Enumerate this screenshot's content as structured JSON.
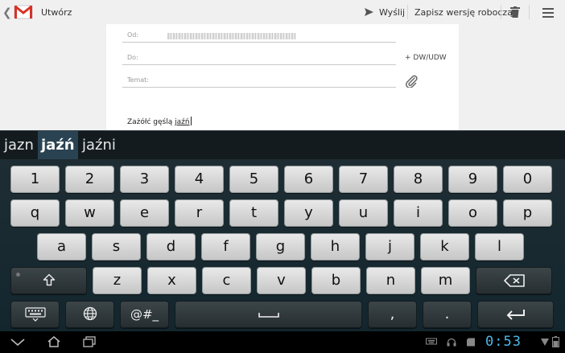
{
  "actionbar": {
    "title": "Utwórz",
    "send_label": "Wyślij",
    "save_draft_label": "Zapisz wersję roboczą"
  },
  "compose": {
    "from_label": "Od:",
    "to_label": "Do:",
    "subject_label": "Temat:",
    "cc_bcc_label": "+ DW/UDW",
    "body_prefix": "Zażółć gęślą ",
    "body_current_word": "jaźń"
  },
  "suggestions": [
    "jazn",
    "jaźń",
    "jaźni"
  ],
  "keyboard": {
    "row_numbers": [
      "1",
      "2",
      "3",
      "4",
      "5",
      "6",
      "7",
      "8",
      "9",
      "0"
    ],
    "row_top": [
      "q",
      "w",
      "e",
      "r",
      "t",
      "y",
      "u",
      "i",
      "o",
      "p"
    ],
    "row_home": [
      "a",
      "s",
      "d",
      "f",
      "g",
      "h",
      "j",
      "k",
      "l"
    ],
    "row_bottom": [
      "z",
      "x",
      "c",
      "v",
      "b",
      "n",
      "m"
    ],
    "symbols_label": "@#_",
    "comma_label": ",",
    "period_label": "."
  },
  "statusbar": {
    "clock": "0:53"
  },
  "colors": {
    "clock": "#4db8e8",
    "suggestion_highlight": "#2a4352"
  }
}
